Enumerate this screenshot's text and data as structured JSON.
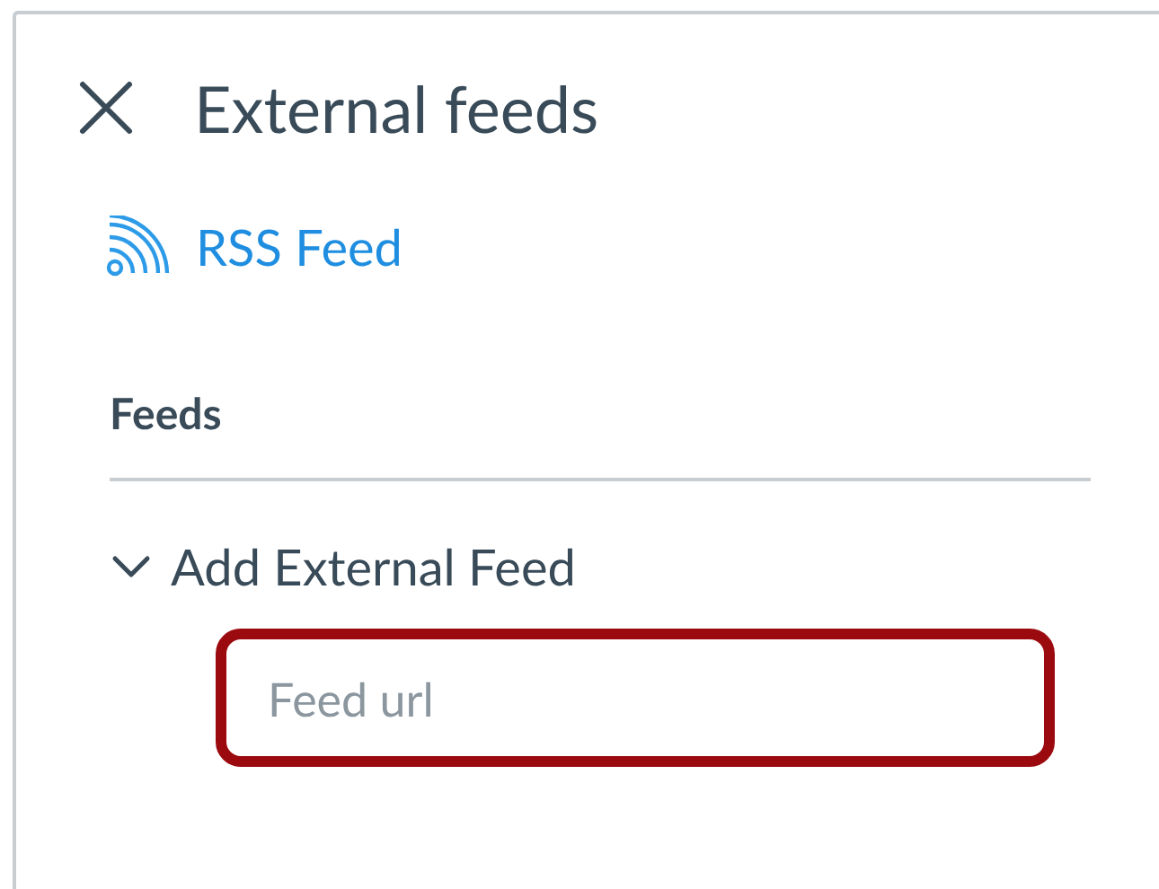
{
  "panel": {
    "title": "External feeds"
  },
  "rss_link": {
    "label": "RSS Feed"
  },
  "section": {
    "heading": "Feeds"
  },
  "add_feed": {
    "label": "Add External Feed",
    "expanded": true
  },
  "feed_url_field": {
    "placeholder": "Feed url"
  }
}
